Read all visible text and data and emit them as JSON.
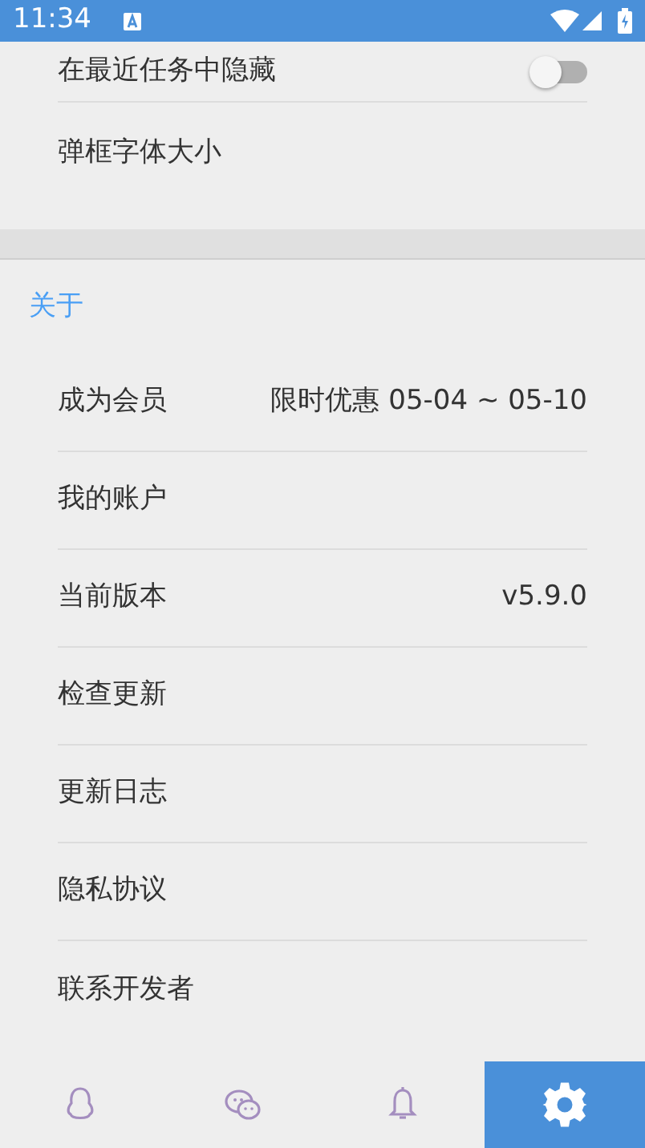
{
  "status_bar": {
    "time": "11:34"
  },
  "general_items": [
    {
      "kind": "toggle",
      "label": "在最近任务中隐藏",
      "on": false
    },
    {
      "kind": "plain",
      "label": "弹框字体大小"
    }
  ],
  "about": {
    "header": "关于",
    "items": [
      {
        "label": "成为会员",
        "value": "限时优惠 05-04 ~ 05-10"
      },
      {
        "label": "我的账户"
      },
      {
        "label": "当前版本",
        "value": "v5.9.0"
      },
      {
        "label": "检查更新"
      },
      {
        "label": "更新日志"
      },
      {
        "label": "隐私协议"
      },
      {
        "label": "联系开发者"
      }
    ]
  },
  "bottom_nav": [
    {
      "selected": false
    },
    {
      "selected": false
    },
    {
      "selected": false
    },
    {
      "selected": true
    }
  ]
}
